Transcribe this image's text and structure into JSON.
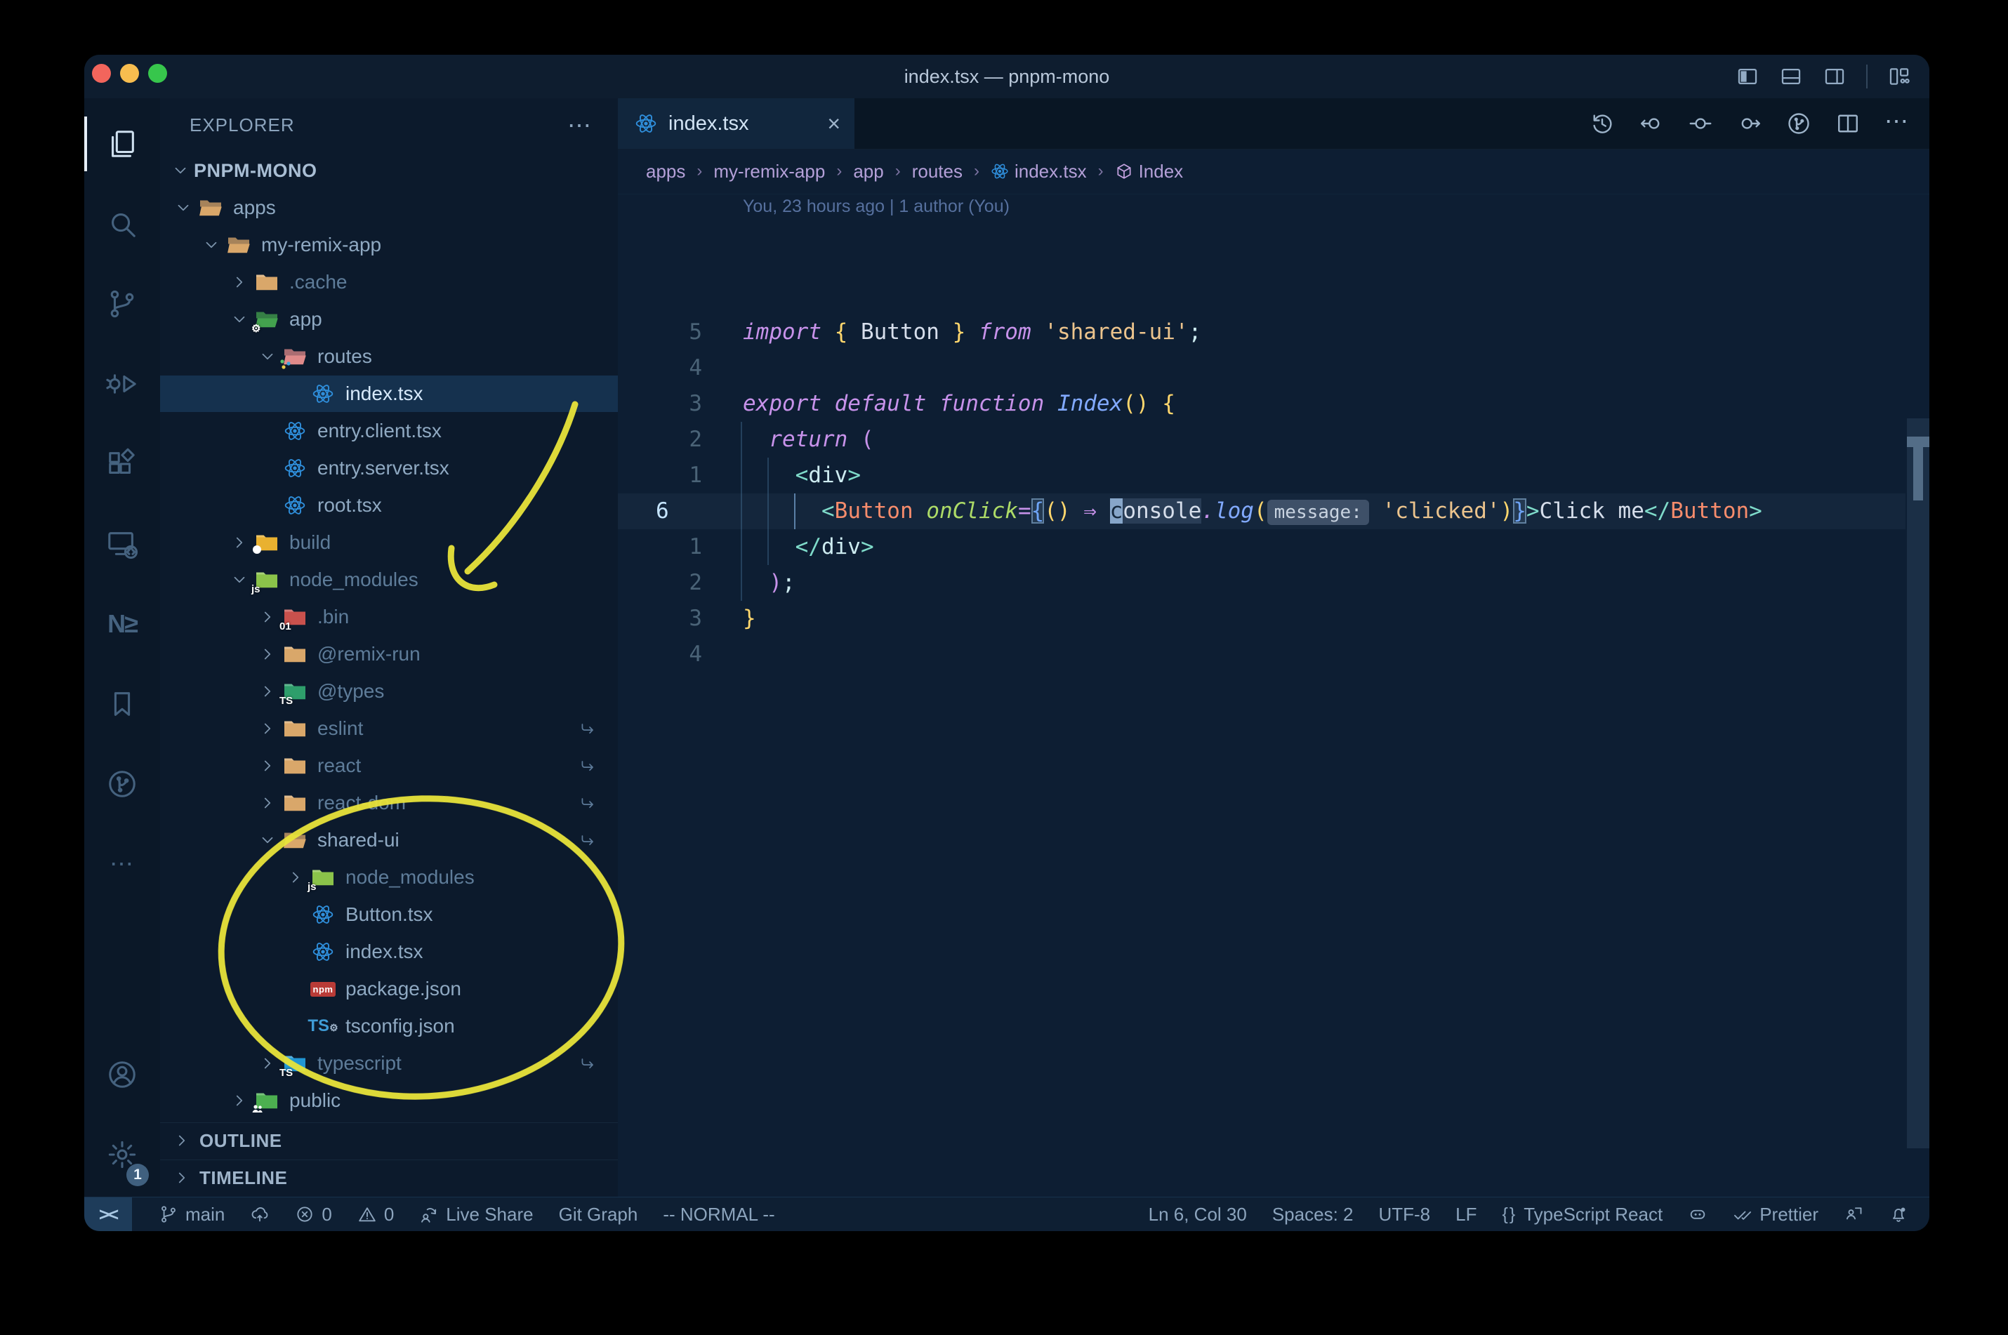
{
  "window": {
    "title": "index.tsx — pnpm-mono",
    "traffic_lights": [
      "close",
      "minimize",
      "zoom"
    ],
    "layout_icons": [
      "panel-left-filled-icon",
      "panel-bottom-icon",
      "panel-right-icon",
      "separator",
      "layout-customize-icon"
    ]
  },
  "colors": {
    "annotation_yellow": "#e9e43a",
    "editor_bg": "#0d1e33",
    "sidebar_bg": "#0c1a2c",
    "keyword": "#c792ea",
    "string": "#ecc48d",
    "function": "#82aaff",
    "component_tag": "#f78c6c",
    "attribute": "#addb67",
    "bracket_teal": "#7fdbca",
    "bracket_gold": "#ffd76d",
    "react_blue": "#2f8fdc",
    "selected_row": "#15314e"
  },
  "activity_bar": {
    "top": [
      {
        "name": "explorer",
        "icon": "files-icon",
        "active": true
      },
      {
        "name": "search",
        "icon": "search-icon"
      },
      {
        "name": "source-control",
        "icon": "git-branch-icon"
      },
      {
        "name": "run-debug",
        "icon": "debug-icon"
      },
      {
        "name": "extensions",
        "icon": "extensions-icon"
      },
      {
        "name": "remote-explorer",
        "icon": "remote-explorer-icon"
      },
      {
        "name": "nx-console",
        "icon": "nx-icon"
      },
      {
        "name": "bookmarks",
        "icon": "bookmark-icon"
      },
      {
        "name": "git-graph",
        "icon": "git-circle-icon"
      },
      {
        "name": "more-views",
        "icon": "ellipsis-icon"
      }
    ],
    "bottom": [
      {
        "name": "accounts",
        "icon": "account-icon"
      },
      {
        "name": "settings",
        "icon": "gear-icon",
        "badge": "1"
      }
    ]
  },
  "explorer": {
    "header": "EXPLORER",
    "outline_label": "OUTLINE",
    "timeline_label": "TIMELINE",
    "tree": [
      {
        "label": "PNPM-MONO",
        "level": 0,
        "chevron": "down",
        "icon": "none",
        "root": true
      },
      {
        "label": "apps",
        "level": 1,
        "chevron": "down",
        "icon": "folder-open-tan"
      },
      {
        "label": "my-remix-app",
        "level": 2,
        "chevron": "down",
        "icon": "folder-open-tan"
      },
      {
        "label": ".cache",
        "level": 3,
        "chevron": "right",
        "icon": "folder-tan",
        "dim": true
      },
      {
        "label": "app",
        "level": 3,
        "chevron": "down",
        "icon": "folder-app"
      },
      {
        "label": "routes",
        "level": 4,
        "chevron": "down",
        "icon": "folder-routes"
      },
      {
        "label": "index.tsx",
        "level": 5,
        "chevron": "none",
        "icon": "react",
        "selected": true
      },
      {
        "label": "entry.client.tsx",
        "level": 4,
        "chevron": "none",
        "icon": "react"
      },
      {
        "label": "entry.server.tsx",
        "level": 4,
        "chevron": "none",
        "icon": "react"
      },
      {
        "label": "root.tsx",
        "level": 4,
        "chevron": "none",
        "icon": "react"
      },
      {
        "label": "build",
        "level": 3,
        "chevron": "right",
        "icon": "folder-dist",
        "dim": true
      },
      {
        "label": "node_modules",
        "level": 3,
        "chevron": "down",
        "icon": "folder-js",
        "dim": true
      },
      {
        "label": ".bin",
        "level": 4,
        "chevron": "right",
        "icon": "folder-bin",
        "dim": true
      },
      {
        "label": "@remix-run",
        "level": 4,
        "chevron": "right",
        "icon": "folder-tan",
        "dim": true
      },
      {
        "label": "@types",
        "level": 4,
        "chevron": "right",
        "icon": "folder-types",
        "dim": true
      },
      {
        "label": "eslint",
        "level": 4,
        "chevron": "right",
        "icon": "folder-tan",
        "dim": true,
        "symlink": true
      },
      {
        "label": "react",
        "level": 4,
        "chevron": "right",
        "icon": "folder-tan",
        "dim": true,
        "symlink": true
      },
      {
        "label": "react-dom",
        "level": 4,
        "chevron": "right",
        "icon": "folder-tan",
        "dim": true,
        "symlink": true
      },
      {
        "label": "shared-ui",
        "level": 4,
        "chevron": "down",
        "icon": "folder-open-tan",
        "symlink": true
      },
      {
        "label": "node_modules",
        "level": 5,
        "chevron": "right",
        "icon": "folder-js",
        "dim": true
      },
      {
        "label": "Button.tsx",
        "level": 5,
        "chevron": "none",
        "icon": "react"
      },
      {
        "label": "index.tsx",
        "level": 5,
        "chevron": "none",
        "icon": "react"
      },
      {
        "label": "package.json",
        "level": 5,
        "chevron": "none",
        "icon": "npm"
      },
      {
        "label": "tsconfig.json",
        "level": 5,
        "chevron": "none",
        "icon": "tsconfig"
      },
      {
        "label": "typescript",
        "level": 4,
        "chevron": "right",
        "icon": "folder-ts",
        "dim": true,
        "symlink": true
      },
      {
        "label": "public",
        "level": 3,
        "chevron": "right",
        "icon": "folder-public"
      }
    ]
  },
  "editor": {
    "tab": {
      "label": "index.tsx",
      "icon": "react",
      "close_glyph": "×"
    },
    "toolbar_icons": [
      {
        "name": "timeline-history",
        "icon": "history-icon"
      },
      {
        "name": "nav-back",
        "icon": "nav-back-icon"
      },
      {
        "name": "nav-current",
        "icon": "nav-dot-icon"
      },
      {
        "name": "nav-forward",
        "icon": "nav-forward-icon"
      },
      {
        "name": "git-graph-view",
        "icon": "git-circle-icon"
      },
      {
        "name": "split-editor",
        "icon": "split-icon"
      },
      {
        "name": "more-actions",
        "icon": "ellipsis-icon"
      }
    ],
    "breadcrumbs": [
      {
        "label": "apps"
      },
      {
        "label": "my-remix-app"
      },
      {
        "label": "app"
      },
      {
        "label": "routes"
      },
      {
        "label": "index.tsx",
        "icon": "react"
      },
      {
        "label": "Index",
        "icon": "symbol-cube-icon"
      }
    ],
    "blame": "You, 23 hours ago | 1 author (You)",
    "lines": [
      {
        "n": "5",
        "tokens": [
          {
            "t": "import ",
            "s": "kw"
          },
          {
            "t": "{ ",
            "s": "gold"
          },
          {
            "t": "Button",
            "s": "txt"
          },
          {
            "t": " } ",
            "s": "gold"
          },
          {
            "t": "from ",
            "s": "kw"
          },
          {
            "t": "'shared-ui'",
            "s": "str"
          },
          {
            "t": ";",
            "s": "pale"
          }
        ]
      },
      {
        "n": "4",
        "tokens": []
      },
      {
        "n": "3",
        "tokens": [
          {
            "t": "export default function ",
            "s": "kw"
          },
          {
            "t": "Index",
            "s": "fn"
          },
          {
            "t": "()",
            "s": "gold"
          },
          {
            "t": " {",
            "s": "gold"
          }
        ]
      },
      {
        "n": "2",
        "tokens": [
          {
            "t": "  ",
            "s": "txt"
          },
          {
            "t": "return ",
            "s": "kw"
          },
          {
            "t": "(",
            "s": "mag"
          }
        ]
      },
      {
        "n": "1",
        "tokens": [
          {
            "t": "    ",
            "s": "txt"
          },
          {
            "t": "<",
            "s": "brk"
          },
          {
            "t": "div",
            "s": "pale"
          },
          {
            "t": ">",
            "s": "brk"
          }
        ]
      },
      {
        "n": "6",
        "cur": true,
        "tokens": [
          {
            "t": "      ",
            "s": "txt"
          },
          {
            "t": "<",
            "s": "brk"
          },
          {
            "t": "Button",
            "s": "tag"
          },
          {
            "t": " ",
            "s": "txt"
          },
          {
            "t": "onClick",
            "s": "attr"
          },
          {
            "t": "=",
            "s": "kw"
          },
          {
            "t": "{",
            "s": "blue",
            "m": true
          },
          {
            "t": "()",
            "s": "gold"
          },
          {
            "t": " ⇒ ",
            "s": "kw"
          },
          {
            "t": "c",
            "s": "cursor"
          },
          {
            "t": "onsole",
            "s": "occ"
          },
          {
            "t": ".",
            "s": "kw"
          },
          {
            "t": "log",
            "s": "fn"
          },
          {
            "t": "(",
            "s": "gold"
          },
          {
            "t": "message:",
            "s": "inlay"
          },
          {
            "t": " ",
            "s": "txt"
          },
          {
            "t": "'clicked'",
            "s": "str"
          },
          {
            "t": ")",
            "s": "gold"
          },
          {
            "t": "}",
            "s": "blue",
            "m": true
          },
          {
            "t": ">",
            "s": "brk"
          },
          {
            "t": "Click me",
            "s": "txt"
          },
          {
            "t": "</",
            "s": "brk"
          },
          {
            "t": "Button",
            "s": "tag"
          },
          {
            "t": ">",
            "s": "brk"
          }
        ]
      },
      {
        "n": "1",
        "tokens": [
          {
            "t": "    ",
            "s": "txt"
          },
          {
            "t": "</",
            "s": "brk"
          },
          {
            "t": "div",
            "s": "pale"
          },
          {
            "t": ">",
            "s": "brk"
          }
        ]
      },
      {
        "n": "2",
        "tokens": [
          {
            "t": "  ",
            "s": "txt"
          },
          {
            "t": ")",
            "s": "mag"
          },
          {
            "t": ";",
            "s": "pale"
          }
        ]
      },
      {
        "n": "3",
        "tokens": [
          {
            "t": "}",
            "s": "gold"
          }
        ]
      },
      {
        "n": "4",
        "tokens": []
      }
    ]
  },
  "status_bar": {
    "left": [
      {
        "name": "remote-indicator",
        "icon": "remote-indicator-icon",
        "text": "",
        "boxed": true
      },
      {
        "name": "git-branch",
        "icon": "git-branch-icon",
        "text": "main"
      },
      {
        "name": "sync-changes",
        "icon": "cloud-upload-icon",
        "text": ""
      },
      {
        "name": "problems-errors",
        "icon": "error-icon",
        "text": "0"
      },
      {
        "name": "problems-warnings",
        "icon": "warning-icon",
        "text": "0"
      },
      {
        "name": "live-share",
        "icon": "live-share-icon",
        "text": "Live Share"
      },
      {
        "name": "git-graph",
        "text": "Git Graph"
      },
      {
        "name": "vim-mode",
        "text": "-- NORMAL --"
      }
    ],
    "right": [
      {
        "name": "cursor-position",
        "text": "Ln 6, Col 30"
      },
      {
        "name": "indentation",
        "text": "Spaces: 2"
      },
      {
        "name": "encoding",
        "text": "UTF-8"
      },
      {
        "name": "eol-sequence",
        "text": "LF"
      },
      {
        "name": "language-mode",
        "icon": "braces-icon",
        "text": "TypeScript React"
      },
      {
        "name": "copilot",
        "icon": "copilot-icon",
        "text": ""
      },
      {
        "name": "formatter-prettier",
        "icon": "double-check-icon",
        "text": "Prettier"
      },
      {
        "name": "feedback",
        "icon": "feedback-icon",
        "text": ""
      },
      {
        "name": "notifications",
        "icon": "bell-dot-icon",
        "text": ""
      }
    ]
  },
  "annotations": {
    "color": "#e9e43a",
    "arrow_target": "node_modules",
    "circle_target": "shared-ui contents"
  }
}
